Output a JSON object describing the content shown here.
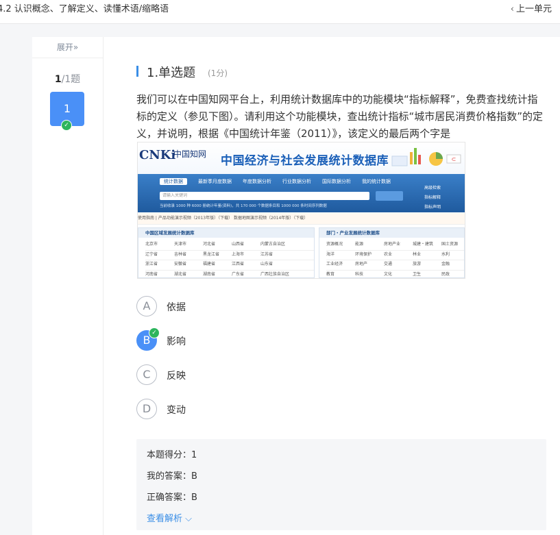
{
  "header": {
    "title": "4.2 认识概念、了解定义、读懂术语/缩略语",
    "prev_label": "上一单元"
  },
  "sidebar": {
    "expand_label": "展开»",
    "counter_current": "1",
    "counter_total": "/1题",
    "question_number": "1"
  },
  "question": {
    "title": "1.单选题",
    "score": "(1分)",
    "stem": "我们可以在中国知网平台上，利用统计数据库中的功能模块“指标解释”，免费查找统计指标的定义（参见下图）。请利用这个功能模块，查出统计指标“城市居民消费价格指数”的定义，并说明，根据《中国统计年鉴（2011）》，该定义的最后两个字是"
  },
  "figure": {
    "logo": "CNKi",
    "logo_sub": "中国知网",
    "title": "中国经济与社会发展统计数据库",
    "tabs": [
      "统计数据",
      "最新季月度数据",
      "年度数据分析",
      "行业数据分析",
      "国际数据分析",
      "我的统计数据"
    ],
    "search_placeholder": "请输入关键词",
    "side_links": [
      "高级检索",
      "指标解释",
      "指标声明"
    ],
    "hint": "当前收录 1000 种 6000 册统计年鉴(资料)，共 170 000 个数据条目和 1000 000 条时间序列数据",
    "band": "使用指南 | 产品功能演示视频（2013年版）（下载）   数据地图演示视频（2014年版）（下载）",
    "left_panel": {
      "title": "中国区域发展统计数据库",
      "rows": [
        [
          "北京市",
          "天津市",
          "河北省",
          "山西省",
          "内蒙古自治区"
        ],
        [
          "辽宁省",
          "吉林省",
          "黑龙江省",
          "上海市",
          "江苏省"
        ],
        [
          "浙江省",
          "安徽省",
          "福建省",
          "江西省",
          "山东省"
        ],
        [
          "河南省",
          "湖北省",
          "湖南省",
          "广东省",
          "广西壮族自治区"
        ]
      ]
    },
    "right_panel": {
      "title": "部门・产业发展统计数据库",
      "rows": [
        [
          "资源概况",
          "能源",
          "房地产业",
          "城建・建筑",
          "国土资源"
        ],
        [
          "海洋",
          "环境保护",
          "农业",
          "林业",
          "水利"
        ],
        [
          "工业经济",
          "房地产",
          "交通",
          "旅游",
          "金融"
        ],
        [
          "教育",
          "科技",
          "文化",
          "卫生",
          "民政"
        ]
      ]
    }
  },
  "options": [
    {
      "letter": "A",
      "text": "依据",
      "selected": false
    },
    {
      "letter": "B",
      "text": "影响",
      "selected": true
    },
    {
      "letter": "C",
      "text": "反映",
      "selected": false
    },
    {
      "letter": "D",
      "text": "变动",
      "selected": false
    }
  ],
  "result": {
    "score_line": "本题得分：1",
    "my_answer": "我的答案：B",
    "correct_answer": "正确答案：B",
    "analysis_label": "查看解析"
  },
  "icons": {
    "prev": "chevron-left-icon",
    "check": "check-icon",
    "analysis": "chevron-down-icon"
  },
  "colors": {
    "accent": "#4a90f7",
    "correct": "#2db55d",
    "link": "#3a8ee6"
  }
}
